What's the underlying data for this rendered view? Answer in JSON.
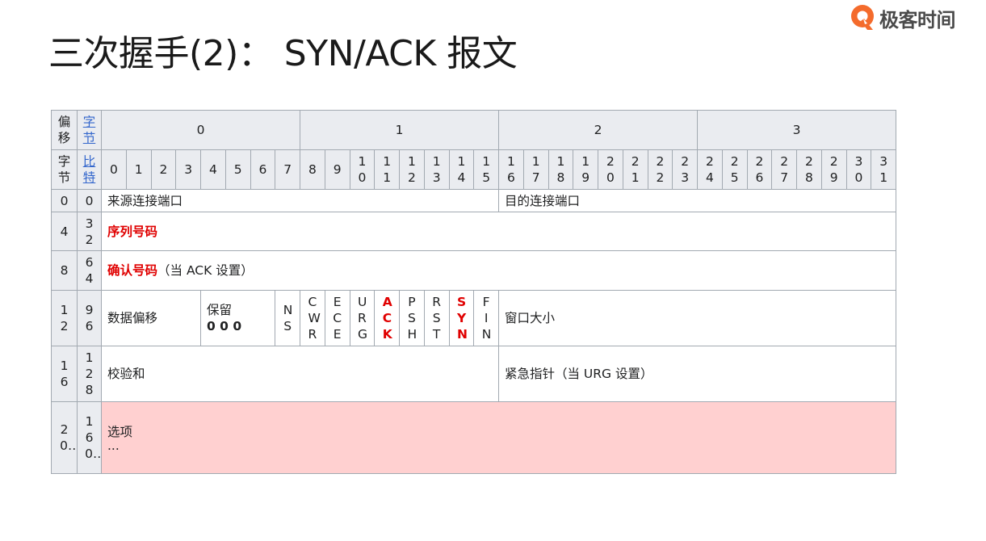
{
  "title": "三次握手(2)： SYN/ACK 报文",
  "logo": {
    "text": "极客时间",
    "icon": "geekbang-q-logo-icon",
    "color": "#f46b2c"
  },
  "table": {
    "corner": {
      "offset": "偏移",
      "byte": "字节",
      "bit": "比特",
      "byte2": "字节"
    },
    "byte_headers": [
      "0",
      "1",
      "2",
      "3"
    ],
    "bit_headers": [
      "0",
      "1",
      "2",
      "3",
      "4",
      "5",
      "6",
      "7",
      "8",
      "9",
      "10",
      "11",
      "12",
      "13",
      "14",
      "15",
      "16",
      "17",
      "18",
      "19",
      "20",
      "21",
      "22",
      "23",
      "24",
      "25",
      "26",
      "27",
      "28",
      "29",
      "30",
      "31"
    ],
    "rows": [
      {
        "byte": "0",
        "bit": "0",
        "src_port": "来源连接端口",
        "dst_port": "目的连接端口"
      },
      {
        "byte": "4",
        "bit": "32",
        "seq": "序列号码"
      },
      {
        "byte": "8",
        "bit": "64",
        "ack_num": "确认号码",
        "ack_note": "（当 ACK 设置）"
      },
      {
        "byte": "12",
        "bit": "96",
        "data_offset": "数据偏移",
        "reserved": "保留",
        "reserved_bits": "0 0 0",
        "flags": [
          "NS",
          "CWR",
          "ECE",
          "URG",
          "ACK",
          "PSH",
          "RST",
          "SYN",
          "FIN"
        ],
        "window": "窗口大小"
      },
      {
        "byte": "16",
        "bit": "128",
        "checksum": "校验和",
        "urgent": "紧急指针（当 URG 设置）"
      },
      {
        "byte": "20…",
        "bit": "160…",
        "options": "选项",
        "ellipsis": "..."
      }
    ],
    "highlight": {
      "flags": [
        "ACK",
        "SYN"
      ],
      "fields": [
        "序列号码",
        "确认号码"
      ],
      "color": "#e00000",
      "options_bg": "#ffd0d0"
    }
  }
}
